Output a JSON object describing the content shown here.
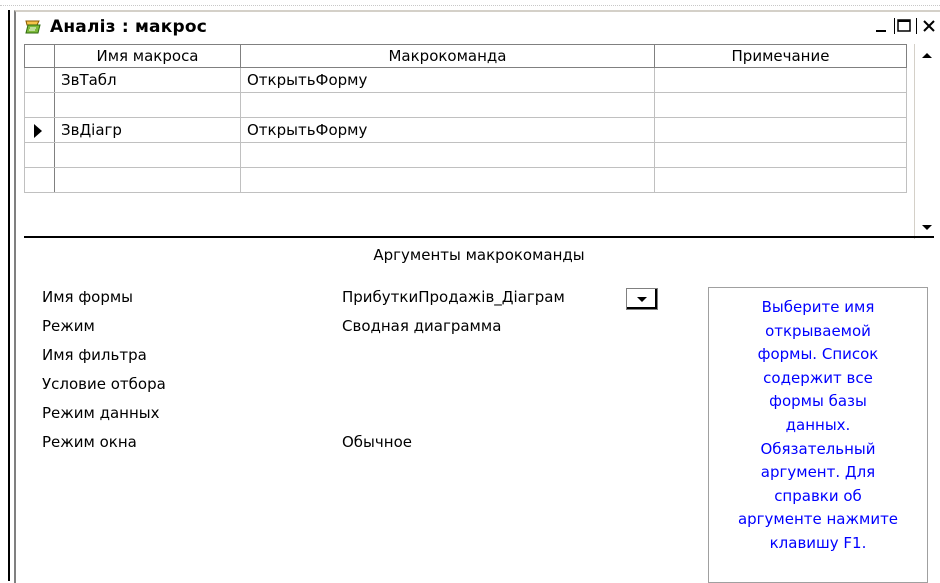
{
  "window": {
    "title": "Аналіз : макрос",
    "controls": [
      "minimize",
      "maximize",
      "close"
    ]
  },
  "grid": {
    "columns": [
      "Имя макроса",
      "Макрокоманда",
      "Примечание"
    ],
    "rows": [
      {
        "name": "ЗвТабл",
        "action": "ОткрытьФорму",
        "note": "",
        "current": false
      },
      {
        "name": "",
        "action": "",
        "note": "",
        "current": false
      },
      {
        "name": "ЗвДіагр",
        "action": "ОткрытьФорму",
        "note": "",
        "current": true
      },
      {
        "name": "",
        "action": "",
        "note": "",
        "current": false
      },
      {
        "name": "",
        "action": "",
        "note": "",
        "current": false
      }
    ]
  },
  "arguments": {
    "title": "Аргументы макрокоманды",
    "items": [
      {
        "label": "Имя формы",
        "value": "ПрибуткиПродажів_Діаграм"
      },
      {
        "label": "Режим",
        "value": "Сводная диаграмма"
      },
      {
        "label": "Имя фильтра",
        "value": ""
      },
      {
        "label": "Условие отбора",
        "value": ""
      },
      {
        "label": "Режим данных",
        "value": ""
      },
      {
        "label": "Режим окна",
        "value": "Обычное"
      }
    ]
  },
  "help": {
    "lines": [
      "Выберите имя",
      "открываемой",
      "формы. Список",
      "содержит все",
      "формы базы",
      "данных.",
      "Обязательный",
      "аргумент. Для",
      "справки об",
      "аргументе нажмите",
      "клавишу F1."
    ],
    "color": "#0000ff"
  }
}
